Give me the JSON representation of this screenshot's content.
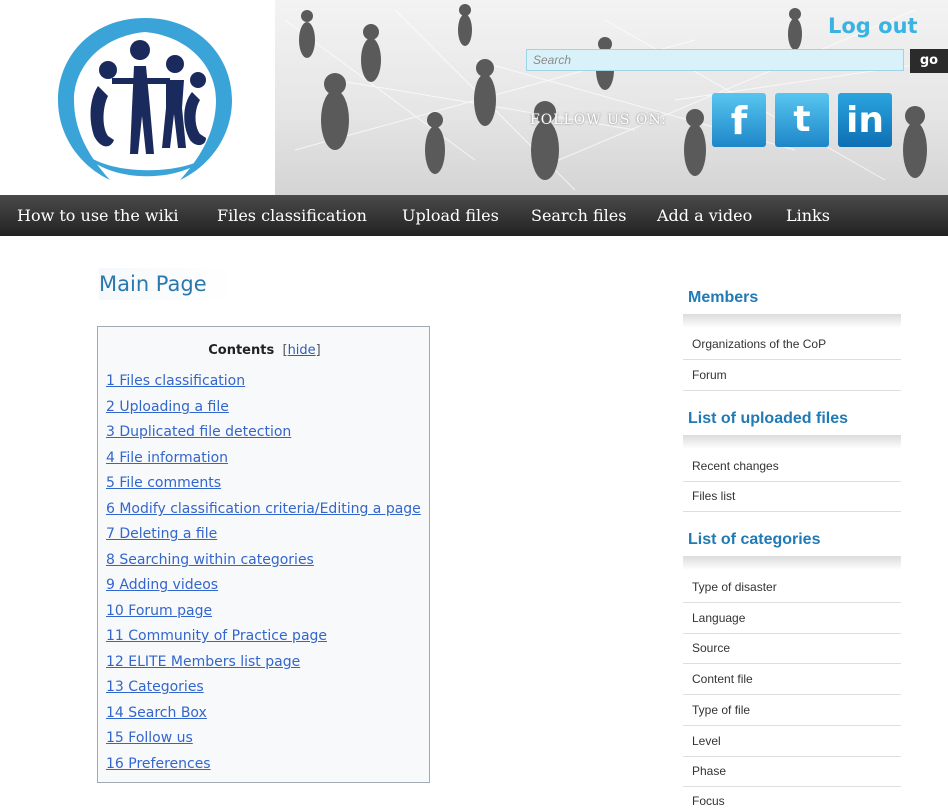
{
  "header": {
    "logout_label": "Log out",
    "search_placeholder": "Search",
    "go_label": "go",
    "follow_label": "FOLLOW US ON:",
    "social": [
      "f",
      "t",
      "in"
    ]
  },
  "nav": [
    "How to use the wiki",
    "Files classification",
    "Upload files",
    "Search files",
    "Add a video",
    "Links"
  ],
  "main": {
    "title": "Main Page",
    "toc": {
      "title": "Contents",
      "hide_label": "hide",
      "items": [
        "1 Files classification",
        "2 Uploading a file",
        "3 Duplicated file detection",
        "4 File information",
        "5 File comments",
        "6 Modify classification criteria/Editing a page",
        "7 Deleting a file",
        "8 Searching within categories",
        "9 Adding videos",
        "10 Forum page",
        "11 Community of Practice page",
        "12 ELITE Members list page",
        "13 Categories",
        "14 Search Box",
        "15 Follow us",
        "16 Preferences"
      ]
    }
  },
  "sidebar": {
    "members": {
      "heading": "Members",
      "items": [
        "Organizations of the CoP",
        "Forum"
      ]
    },
    "uploaded": {
      "heading": "List of uploaded files",
      "items": [
        "Recent changes",
        "Files list"
      ]
    },
    "categories": {
      "heading": "List of categories",
      "items": [
        "Type of disaster",
        "Language",
        "Source",
        "Content file",
        "Type of file",
        "Level",
        "Phase",
        "Focus"
      ]
    }
  },
  "colors": {
    "accent": "#1f7ab5",
    "link": "#3366cc",
    "logo_blue": "#3aa3d8",
    "logo_navy": "#1b2a5c",
    "nav_bg": "#333333"
  }
}
